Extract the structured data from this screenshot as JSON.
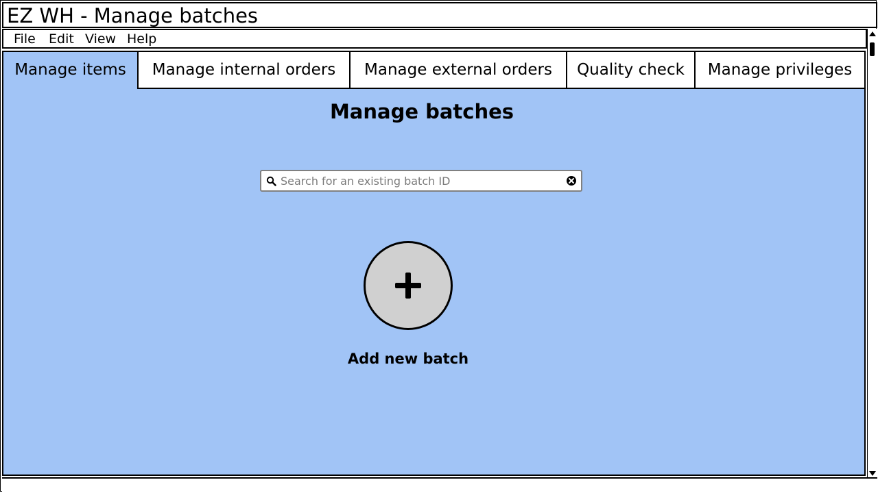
{
  "window": {
    "title": "EZ WH - Manage batches"
  },
  "menubar": {
    "items": [
      {
        "label": "File"
      },
      {
        "label": "Edit"
      },
      {
        "label": "View"
      },
      {
        "label": "Help"
      }
    ]
  },
  "tabs": [
    {
      "label": "Manage items",
      "active": true
    },
    {
      "label": "Manage internal orders",
      "active": false
    },
    {
      "label": "Manage external orders",
      "active": false
    },
    {
      "label": "Quality check",
      "active": false
    },
    {
      "label": "Manage privileges",
      "active": false
    }
  ],
  "main": {
    "page_title": "Manage batches",
    "search": {
      "placeholder": "Search for an existing batch ID",
      "value": "",
      "icon": "search-icon",
      "clear_icon": "close-icon"
    },
    "add_button": {
      "icon": "plus-icon",
      "label": "Add new batch"
    }
  },
  "colors": {
    "content_background": "#a1c4f6",
    "active_tab": "#a1c4f6",
    "add_button_fill": "#d0d0d0"
  }
}
